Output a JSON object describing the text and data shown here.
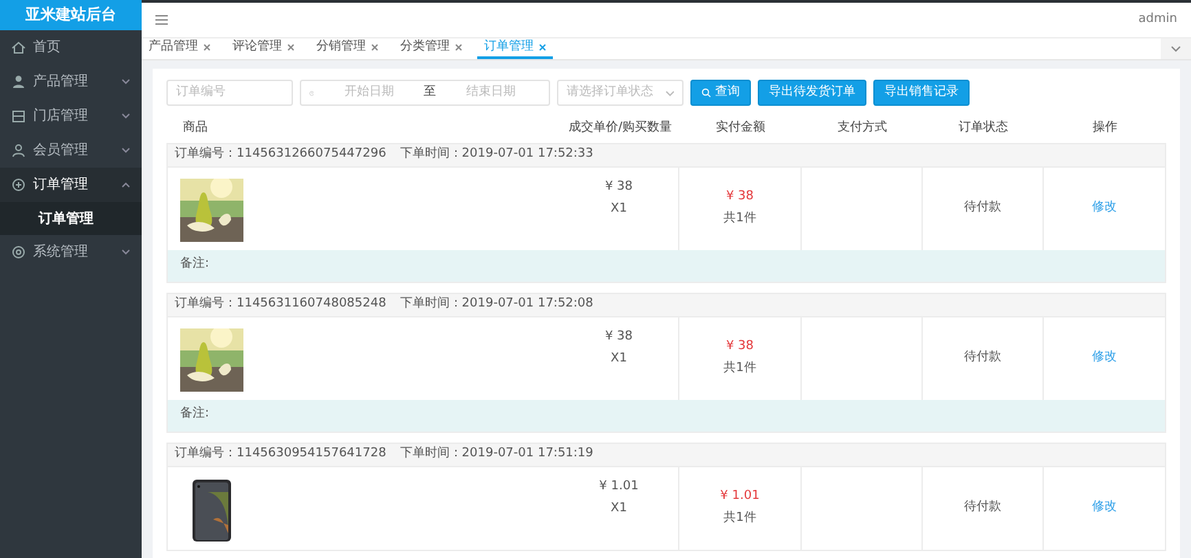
{
  "sidebar": {
    "title": "亚米建站后台",
    "items": [
      {
        "label": "首页",
        "kind": "link"
      },
      {
        "label": "产品管理",
        "kind": "group",
        "expanded": false
      },
      {
        "label": "门店管理",
        "kind": "group",
        "expanded": false
      },
      {
        "label": "会员管理",
        "kind": "group",
        "expanded": false
      },
      {
        "label": "订单管理",
        "kind": "group",
        "expanded": true,
        "children": [
          {
            "label": "订单管理",
            "selected": true
          }
        ]
      },
      {
        "label": "系统管理",
        "kind": "group",
        "expanded": false
      }
    ]
  },
  "header": {
    "user": "admin"
  },
  "tabs": [
    {
      "label": "产品管理",
      "selected": false
    },
    {
      "label": "评论管理",
      "selected": false
    },
    {
      "label": "分销管理",
      "selected": false
    },
    {
      "label": "分类管理",
      "selected": false
    },
    {
      "label": "订单管理",
      "selected": true
    }
  ],
  "filters": {
    "order_no": {
      "placeholder": "订单编号"
    },
    "date_start": {
      "placeholder": "开始日期"
    },
    "date_sep": "至",
    "date_end": {
      "placeholder": "结束日期"
    },
    "status": {
      "placeholder": "请选择订单状态"
    },
    "buttons": [
      {
        "label": "查询",
        "kind": "search"
      },
      {
        "label": "导出待发货订单",
        "kind": "plain"
      },
      {
        "label": "导出销售记录",
        "kind": "plain"
      }
    ]
  },
  "columns": [
    "商品",
    "成交单价/购买数量",
    "实付金额",
    "支付方式",
    "订单状态",
    "操作"
  ],
  "orders": [
    {
      "order_no": "订单编号：1145631266075447296",
      "time": "下单时间：2019-07-01 17:52:33",
      "price": "¥ 38",
      "qty": "X1",
      "paid": "¥ 38",
      "count": "共1件",
      "status": "待付款",
      "action": "修改",
      "remark": "备注:"
    },
    {
      "order_no": "订单编号：1145631160748085248",
      "time": "下单时间：2019-07-01 17:52:08",
      "price": "¥ 38",
      "qty": "X1",
      "paid": "¥ 38",
      "count": "共1件",
      "status": "待付款",
      "action": "修改",
      "remark": "备注:"
    },
    {
      "order_no": "订单编号：1145630954157641728",
      "time": "下单时间：2019-07-01 17:51:19",
      "price": "¥ 1.01",
      "qty": "X1",
      "paid": "¥ 1.01",
      "count": "共1件",
      "status": "待付款",
      "action": "修改"
    }
  ]
}
